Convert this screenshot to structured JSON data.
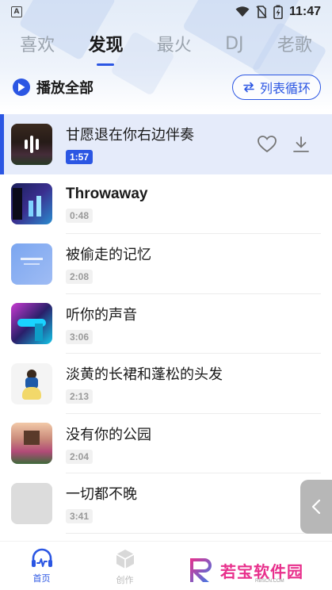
{
  "status_bar": {
    "time": "11:47",
    "left_icon": "A",
    "icons": [
      "wifi-icon",
      "no-sim-icon",
      "battery-charging-icon"
    ]
  },
  "tabs": [
    {
      "label": "喜欢",
      "active": false
    },
    {
      "label": "发现",
      "active": true
    },
    {
      "label": "最火",
      "active": false
    },
    {
      "label": "DJ",
      "active": false
    },
    {
      "label": "老歌",
      "active": false
    }
  ],
  "controls": {
    "play_all_label": "播放全部",
    "loop_mode_label": "列表循环"
  },
  "songs": [
    {
      "title": "甘愿退在你右边伴奏",
      "duration": "1:57",
      "playing": true
    },
    {
      "title": "Throwaway",
      "duration": "0:48",
      "playing": false
    },
    {
      "title": "被偷走的记忆",
      "duration": "2:08",
      "playing": false
    },
    {
      "title": "听你的声音",
      "duration": "3:06",
      "playing": false
    },
    {
      "title": "淡黄的长裙和蓬松的头发",
      "duration": "2:13",
      "playing": false
    },
    {
      "title": "没有你的公园",
      "duration": "2:04",
      "playing": false
    },
    {
      "title": "一切都不晚",
      "duration": "3:41",
      "playing": false
    }
  ],
  "bottom_nav": [
    {
      "label": "首页",
      "icon": "headphones-pulse-icon",
      "active": true
    },
    {
      "label": "创作",
      "icon": "cube-icon",
      "active": false
    }
  ],
  "watermark": {
    "text": "若宝软件园",
    "sub": "RBSCN.COM"
  },
  "colors": {
    "accent": "#2b56e3",
    "active_row_bg": "#e5ebfa",
    "watermark": "#e8308c"
  }
}
